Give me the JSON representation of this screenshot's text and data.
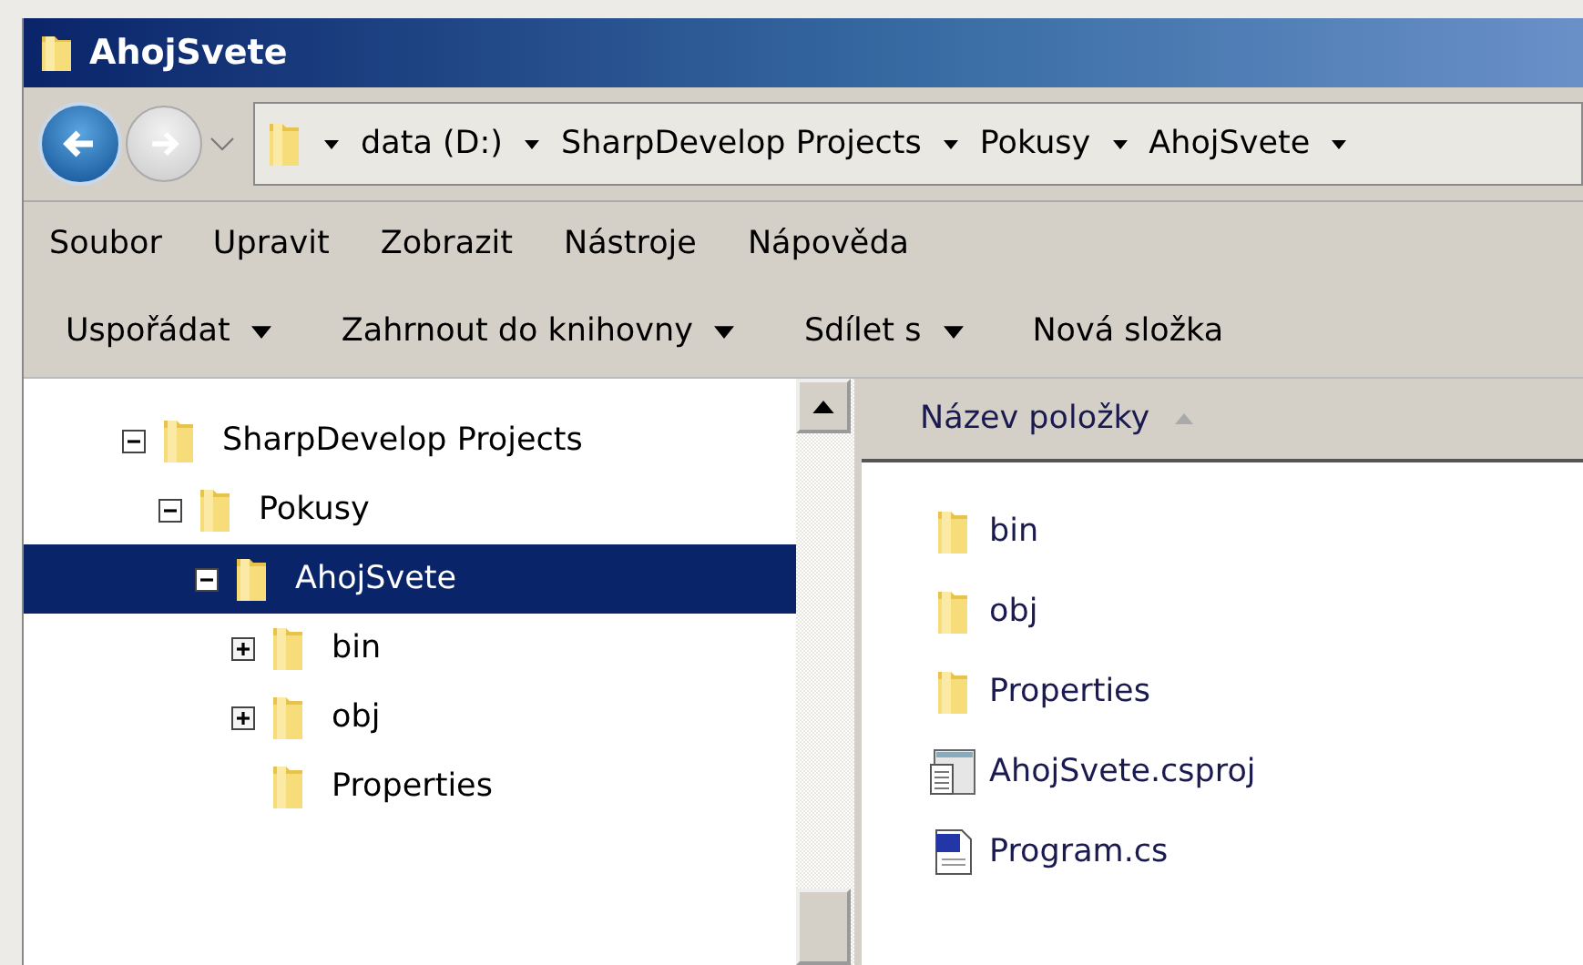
{
  "window": {
    "title": "AhojSvete"
  },
  "breadcrumb": [
    "data (D:)",
    "SharpDevelop Projects",
    "Pokusy",
    "AhojSvete"
  ],
  "menu": [
    "Soubor",
    "Upravit",
    "Zobrazit",
    "Nástroje",
    "Nápověda"
  ],
  "toolbar": [
    {
      "label": "Uspořádat",
      "dropdown": true
    },
    {
      "label": "Zahrnout do knihovny",
      "dropdown": true
    },
    {
      "label": "Sdílet s",
      "dropdown": true
    },
    {
      "label": "Nová složka",
      "dropdown": false
    }
  ],
  "tree": [
    {
      "label": "SharpDevelop Projects",
      "expandable": true,
      "expanded": true,
      "selected": false,
      "children": [
        {
          "label": "Pokusy",
          "expandable": true,
          "expanded": true,
          "selected": false,
          "children": [
            {
              "label": "AhojSvete",
              "expandable": true,
              "expanded": true,
              "selected": true,
              "children": [
                {
                  "label": "bin",
                  "expandable": true,
                  "expanded": false,
                  "selected": false
                },
                {
                  "label": "obj",
                  "expandable": true,
                  "expanded": false,
                  "selected": false
                },
                {
                  "label": "Properties",
                  "expandable": false,
                  "selected": false
                }
              ]
            }
          ]
        }
      ]
    }
  ],
  "file_list": {
    "column": "Název položky",
    "items": [
      {
        "name": "bin",
        "kind": "folder"
      },
      {
        "name": "obj",
        "kind": "folder"
      },
      {
        "name": "Properties",
        "kind": "folder"
      },
      {
        "name": "AhojSvete.csproj",
        "kind": "project"
      },
      {
        "name": "Program.cs",
        "kind": "csharp"
      }
    ]
  }
}
